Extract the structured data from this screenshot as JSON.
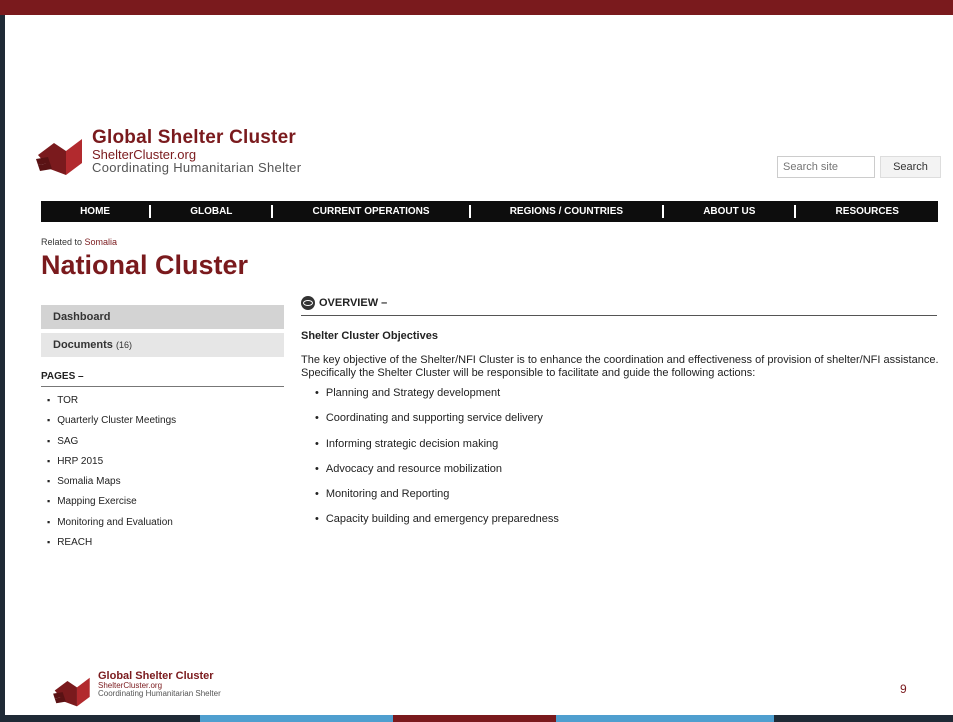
{
  "logo": {
    "title": "Global Shelter Cluster",
    "domain": "ShelterCluster.org",
    "tagline": "Coordinating Humanitarian Shelter"
  },
  "search": {
    "placeholder": "Search site",
    "button": "Search"
  },
  "nav": [
    "HOME",
    "GLOBAL",
    "CURRENT OPERATIONS",
    "REGIONS / COUNTRIES",
    "ABOUT US",
    "RESOURCES"
  ],
  "header": {
    "related_prefix": "Related to",
    "related_link": "Somalia",
    "title": "National Cluster"
  },
  "sidebar": {
    "dashboard": "Dashboard",
    "documents": "Documents",
    "documents_count": "(16)",
    "pages_heading": "PAGES –",
    "pages": [
      "TOR",
      "Quarterly Cluster Meetings",
      "SAG",
      "HRP 2015",
      "Somalia Maps",
      "Mapping Exercise",
      "Monitoring and Evaluation",
      "REACH"
    ]
  },
  "main": {
    "overview": "OVERVIEW –",
    "heading": "Shelter Cluster Objectives",
    "intro": "The key objective of the Shelter/NFI Cluster is to enhance the coordination and effectiveness of provision of shelter/NFI assistance. Specifically the Shelter Cluster will be responsible to facilitate and guide the following actions:",
    "objectives": [
      "Planning and Strategy development",
      "Coordinating and supporting service delivery",
      "Informing strategic decision making",
      "Advocacy and resource mobilization",
      "Monitoring and Reporting",
      "Capacity building and emergency preparedness"
    ]
  },
  "footer": {
    "title": "Global Shelter Cluster",
    "domain": "ShelterCluster.org",
    "tagline": "Coordinating Humanitarian Shelter",
    "slide_number": "9"
  },
  "colors": {
    "brand": "#7a1a1d",
    "nav_bg": "#0d0d0d",
    "bottom_bar": [
      "#1f2a36",
      "#4f9fcf",
      "#7a1a1d",
      "#4f9fcf",
      "#1f2a36"
    ]
  }
}
